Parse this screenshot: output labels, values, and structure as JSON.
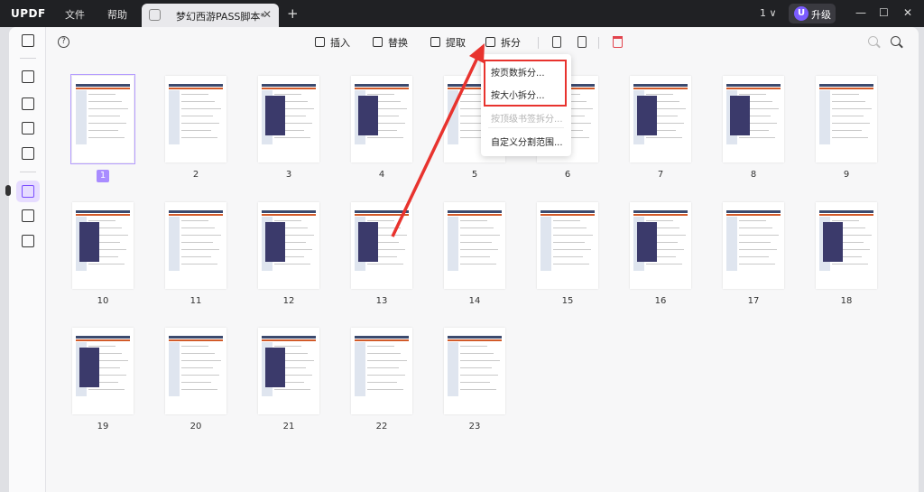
{
  "app": {
    "logo": "UPDF",
    "menu": [
      "文件",
      "帮助"
    ]
  },
  "tab": {
    "title": "梦幻西游PASS脚本*",
    "close": "✕",
    "new_tab": "+"
  },
  "titlebar": {
    "page_indicator": "1 ∨",
    "avatar_letter": "U",
    "upgrade_label": "升级",
    "minimize": "—",
    "maximize": "☐",
    "close": "✕"
  },
  "toolbar": {
    "help": "?",
    "insert_label": "插入",
    "replace_label": "替换",
    "extract_label": "提取",
    "split_label": "拆分"
  },
  "split_menu": {
    "items": [
      {
        "label": "按页数拆分...",
        "enabled": true
      },
      {
        "label": "按大小拆分...",
        "enabled": true
      },
      {
        "label": "按顶级书签拆分...",
        "enabled": false
      },
      {
        "label": "自定义分割范围...",
        "enabled": true
      }
    ]
  },
  "pages": {
    "selected": 1,
    "labels": [
      "1",
      "2",
      "3",
      "4",
      "5",
      "6",
      "7",
      "8",
      "9",
      "10",
      "11",
      "12",
      "13",
      "14",
      "15",
      "16",
      "17",
      "18",
      "19",
      "20",
      "21",
      "22",
      "23"
    ]
  },
  "colors": {
    "accent": "#7a4dff",
    "annotation_red": "#e8332e",
    "title_bar": "#202124"
  }
}
